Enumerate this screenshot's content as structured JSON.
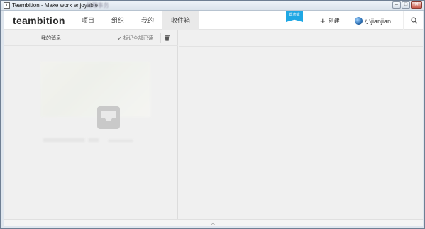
{
  "window": {
    "logo_letter": "t",
    "title": "Teambition - Make work enjoyable",
    "blurred_title": "·处理事务",
    "minimize": "–",
    "maximize": "□",
    "close": "✕"
  },
  "header": {
    "brand": "teambition",
    "nav": [
      {
        "label": "项目"
      },
      {
        "label": "组织"
      },
      {
        "label": "我的"
      },
      {
        "label": "收件箱"
      }
    ],
    "new_badge": "帮功能",
    "create_label": "创建",
    "user_name": "小jianjian"
  },
  "inbox": {
    "title": "我的消息",
    "mark_all_read": "标记全部已读"
  },
  "colors": {
    "accent": "#1ea7e4",
    "background": "#f0f0f0",
    "active_tab": "#e9e9e9"
  },
  "icons": {
    "create": "plus-icon",
    "search": "search-icon",
    "mark_read": "check-icon",
    "delete": "trash-icon",
    "empty": "inbox-tray-icon",
    "collapse": "chevron-up-icon"
  }
}
